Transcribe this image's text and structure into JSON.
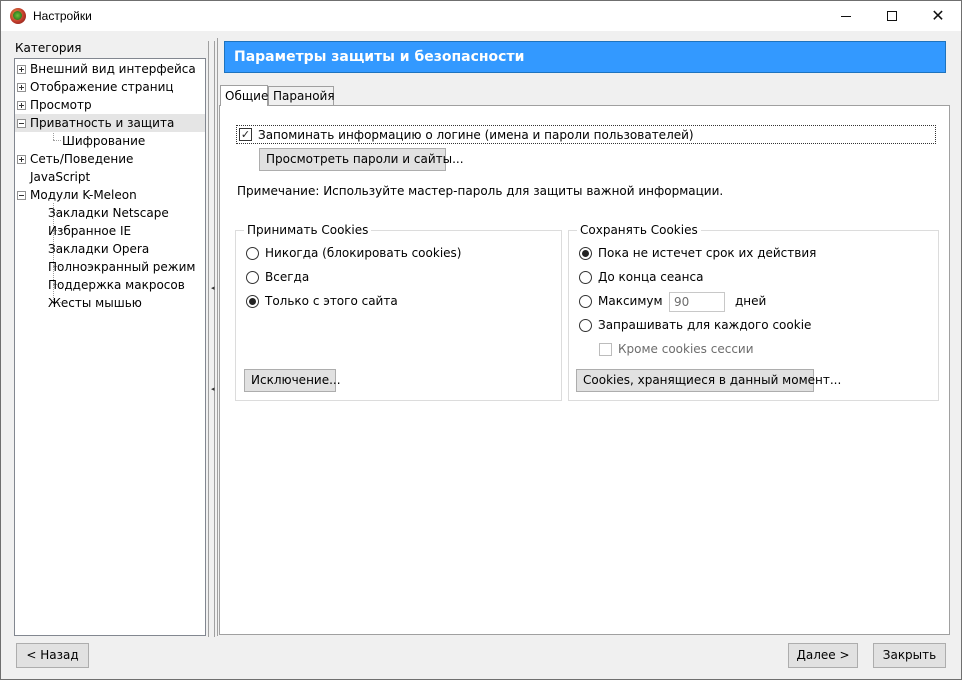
{
  "window": {
    "title": "Настройки"
  },
  "sidebar": {
    "category_label": "Категория",
    "items": [
      {
        "label": "Внешний вид интерфейса",
        "expander": "plus"
      },
      {
        "label": "Отображение страниц",
        "expander": "plus"
      },
      {
        "label": "Просмотр",
        "expander": "plus"
      },
      {
        "label": "Приватность и защита",
        "expander": "minus",
        "selected": true
      },
      {
        "label": "Шифрование",
        "child": true
      },
      {
        "label": "Сеть/Поведение",
        "expander": "plus"
      },
      {
        "label": "JavaScript"
      },
      {
        "label": "Модули K-Meleon",
        "expander": "minus"
      },
      {
        "label": "Закладки Netscape",
        "child": true
      },
      {
        "label": "Избранное IE",
        "child": true
      },
      {
        "label": "Закладки Opera",
        "child": true
      },
      {
        "label": "Полноэкранный режим",
        "child": true
      },
      {
        "label": "Поддержка макросов",
        "child": true
      },
      {
        "label": "Жесты мышью",
        "child": true
      }
    ]
  },
  "main": {
    "header": "Параметры защиты и безопасности",
    "header_color": "#3399ff",
    "tabs": [
      {
        "label": "Общие",
        "active": true
      },
      {
        "label": "Паранойя",
        "active": false
      }
    ],
    "remember_login": {
      "label": "Запоминать информацию о логине (имена и пароли пользователей)",
      "checked": true,
      "check_glyph": "✓"
    },
    "view_passwords_button": "Просмотреть пароли и сайты...",
    "note": "Примечание: Используйте мастер-пароль для защиты важной информации.",
    "accept_cookies": {
      "title": "Принимать Cookies",
      "options": [
        {
          "label": "Никогда (блокировать cookies)",
          "checked": false
        },
        {
          "label": "Всегда",
          "checked": false
        },
        {
          "label": "Только с этого сайта",
          "checked": true
        }
      ],
      "exceptions_button": "Исключение..."
    },
    "keep_cookies": {
      "title": "Сохранять Cookies",
      "options": [
        {
          "label": "Пока не истечет срок их действия",
          "checked": true
        },
        {
          "label": "До конца сеанса",
          "checked": false
        },
        {
          "label": "Максимум",
          "checked": false
        },
        {
          "label": "Запрашивать для каждого cookie",
          "checked": false
        }
      ],
      "max_days_value": "90",
      "days_unit": "дней",
      "except_session_label": "Кроме cookies сессии",
      "except_session_checked": false,
      "cookies_button": "Cookies, хранящиеся в данный момент..."
    }
  },
  "footer": {
    "back_button": "< Назад",
    "next_button": "Далее >",
    "close_button": "Закрыть"
  }
}
